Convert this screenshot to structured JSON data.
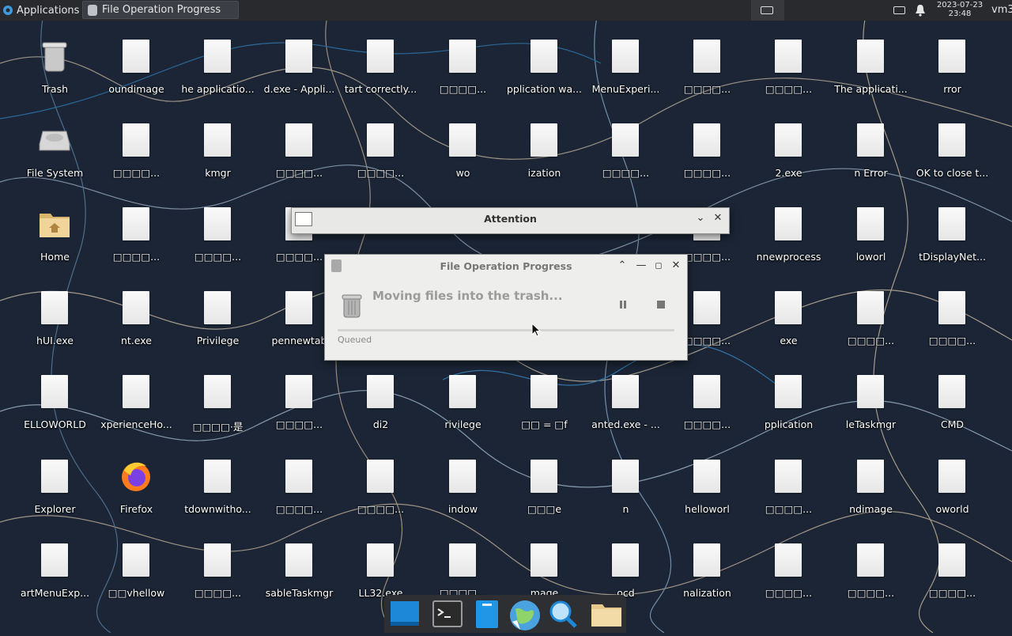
{
  "panel": {
    "applications_label": "Applications",
    "task_title": "File Operation Progress",
    "clock_date": "2023-07-23",
    "clock_time": "23:48",
    "user": "vm3"
  },
  "desktop": {
    "rows": [
      [
        "Trash",
        "oundimage",
        "he applicatio...",
        "d.exe - Appli...",
        "tart correctly...",
        "□□□□...",
        "pplication wa...",
        "MenuExperi...",
        "□□□□...",
        "□□□□...",
        "The applicati...",
        "rror"
      ],
      [
        "File System",
        "□□□□...",
        "kmgr",
        "□□□□...",
        "□□□□...",
        "wo",
        "ization",
        "□□□□...",
        "□□□□...",
        "2.exe",
        "n Error",
        "OK to close t..."
      ],
      [
        "Home",
        "□□□□...",
        "□□□□...",
        "□□□□...",
        "",
        "",
        "",
        "",
        "□□□□...",
        "nnewprocess",
        "loworl",
        "tDisplayNet..."
      ],
      [
        "hUI.exe",
        "nt.exe",
        "Privilege",
        "pennewtab",
        "",
        "",
        "",
        "",
        "□□□□...",
        "exe",
        "□□□□...",
        "□□□□..."
      ],
      [
        "ELLOWORLD",
        "xperienceHo...",
        "□□□□·是",
        "□□□□...",
        "di2",
        "rivilege",
        "□□ = □f",
        "anted.exe - ...",
        "□□□□...",
        "pplication",
        "leTaskmgr",
        "CMD"
      ],
      [
        "Explorer",
        "Firefox",
        "tdownwitho...",
        "□□□□...",
        "□□□□...",
        "indow",
        "□□□e",
        "n",
        "helloworl",
        "□□□□...",
        "ndimage",
        "oworld"
      ],
      [
        "artMenuExp...",
        "□□vhellow",
        "□□□□...",
        "sableTaskmgr",
        "LL32.exe",
        "□□□□...",
        "mage",
        "ocd",
        "nalization",
        "□□□□...",
        "□□□□...",
        "□□□□..."
      ]
    ]
  },
  "attention_window": {
    "title": "Attention"
  },
  "progress_window": {
    "title": "File Operation Progress",
    "message": "Moving files into the trash...",
    "status": "Queued",
    "progress_fraction": 0.0
  },
  "dock": {
    "items": [
      "show-desktop-icon",
      "terminal-icon",
      "file-manager-icon",
      "web-browser-icon",
      "search-icon",
      "folder-icon"
    ]
  },
  "colors": {
    "panel_bg": "#282a2e",
    "wallpaper_bg": "#1b2535",
    "window_bg": "#eeeeec"
  }
}
